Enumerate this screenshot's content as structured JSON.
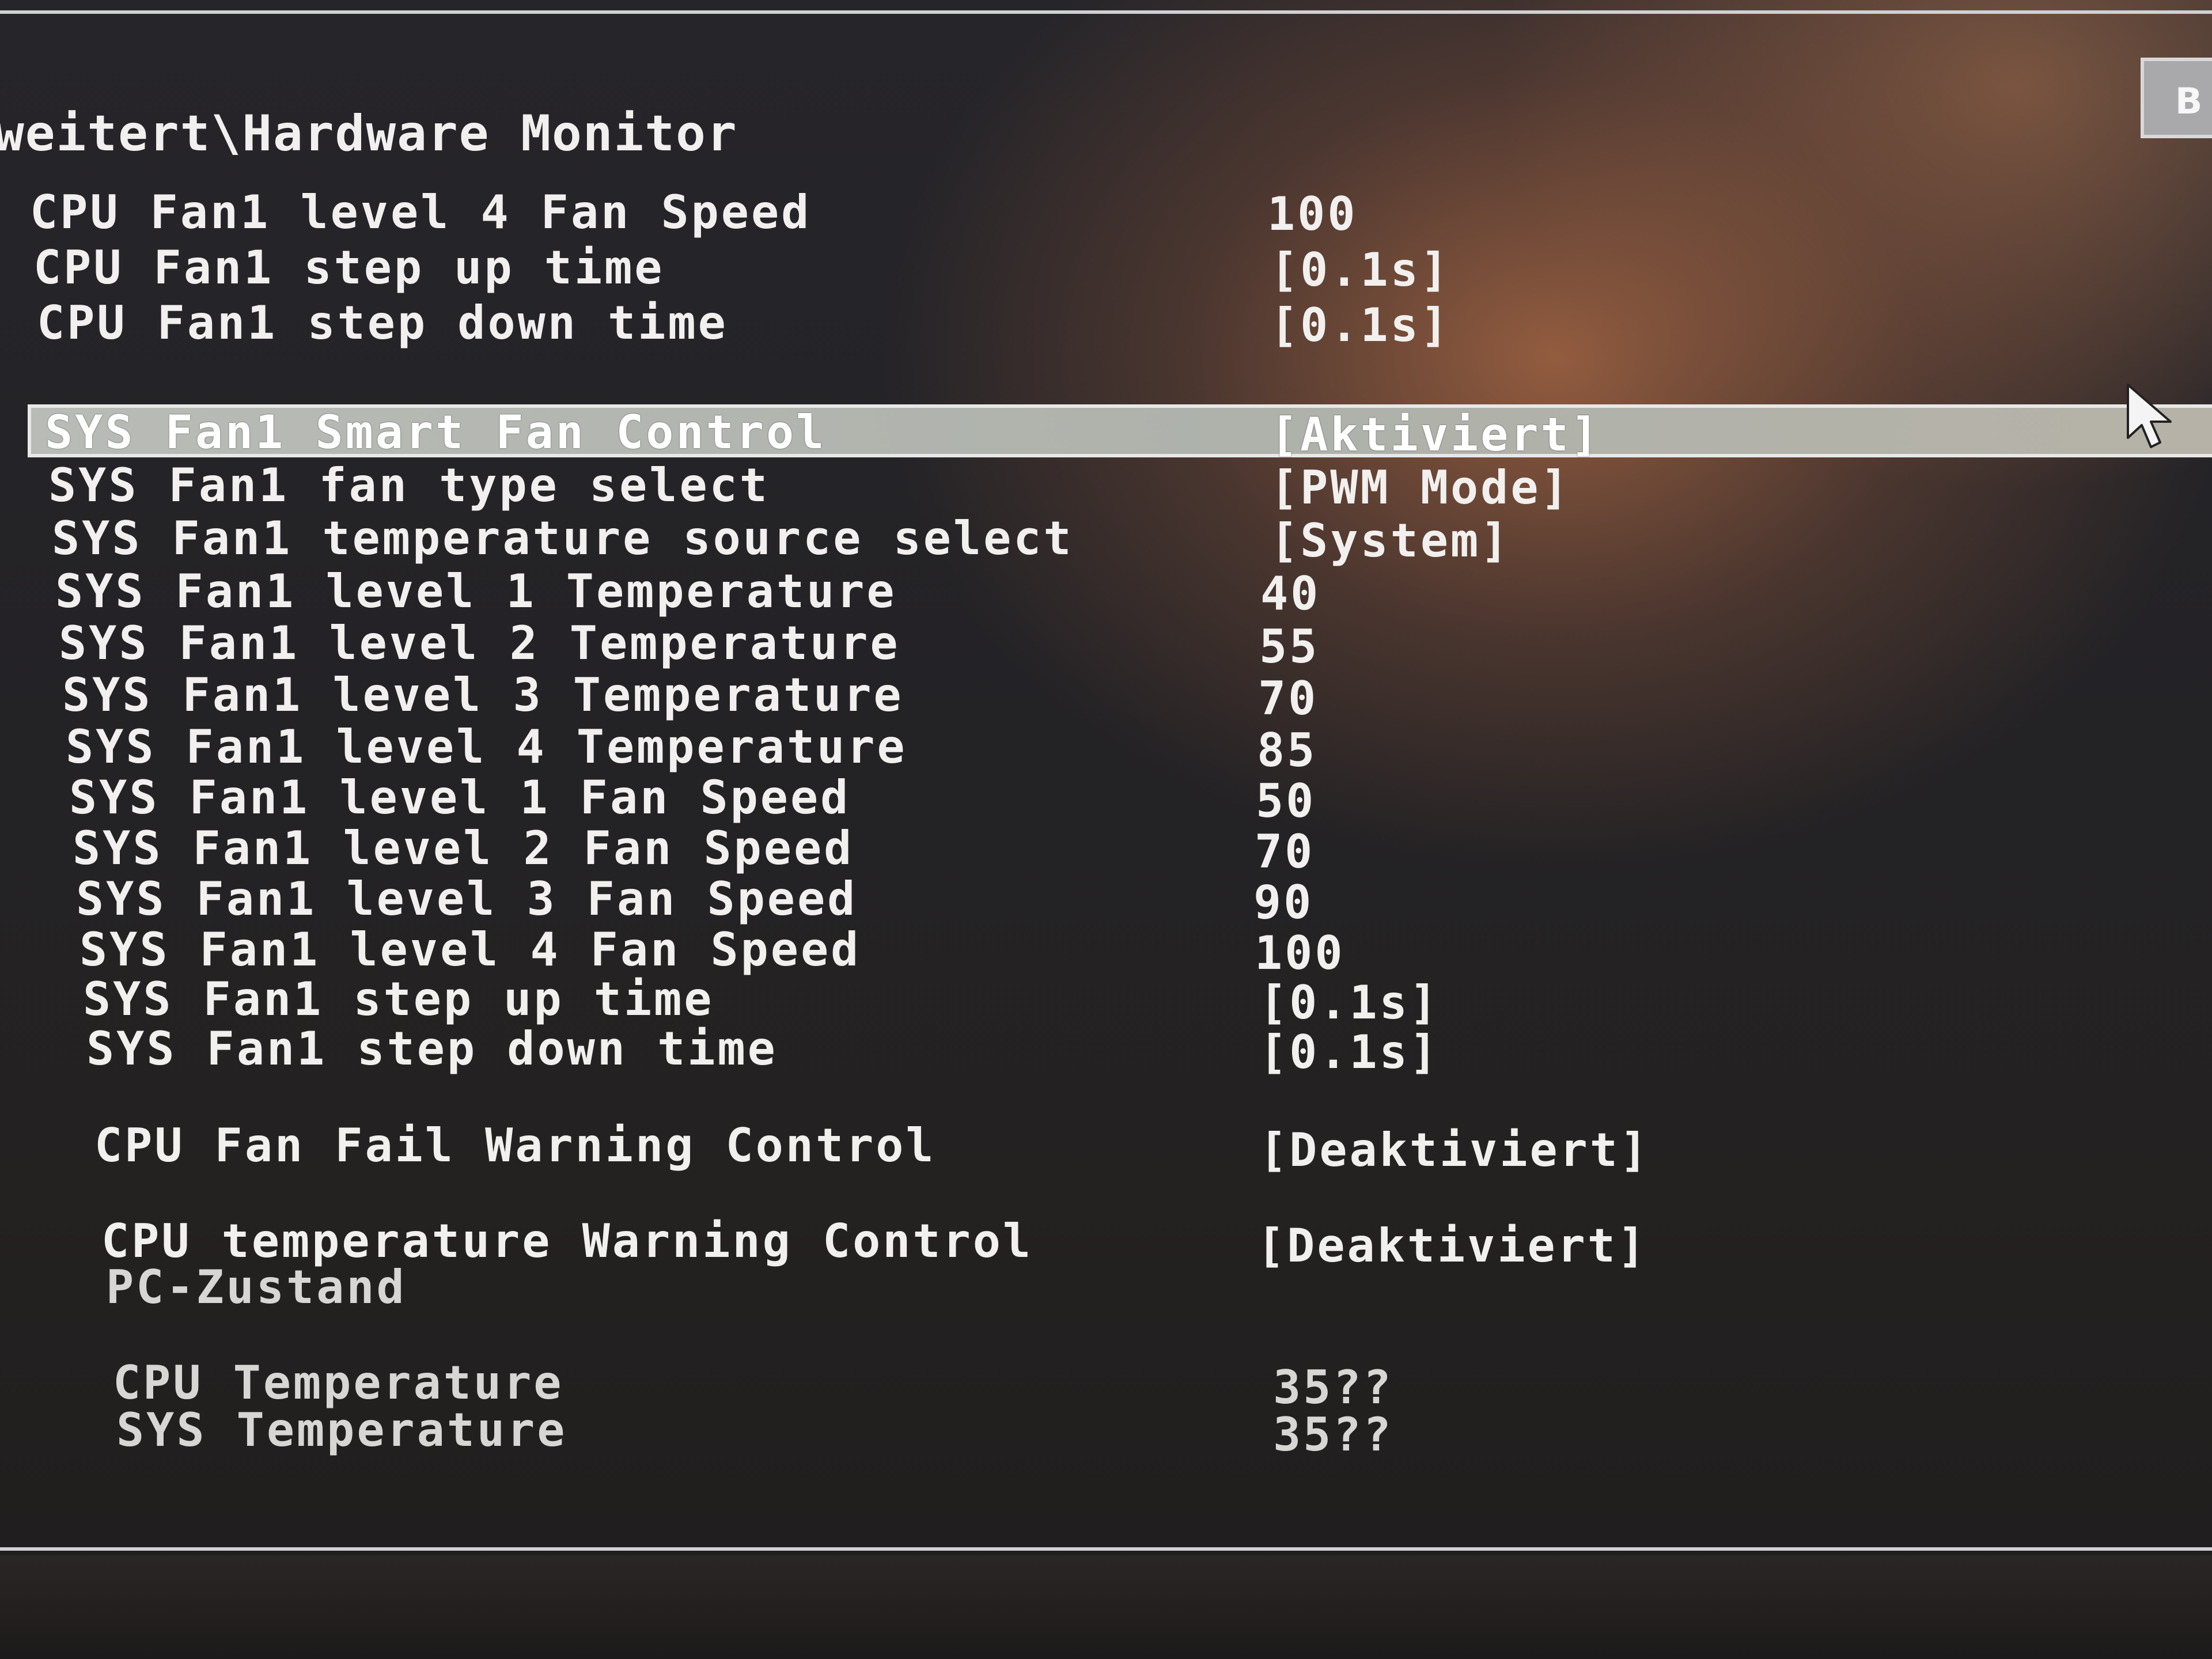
{
  "breadcrumb": "weitert\\Hardware Monitor",
  "back_button": "B",
  "cpu_fan_rows": [
    {
      "label": "CPU Fan1 level 4 Fan Speed",
      "value": "100"
    },
    {
      "label": "CPU Fan1 step up time",
      "value": "[0.1s]"
    },
    {
      "label": "CPU Fan1 step down time",
      "value": "[0.1s]"
    }
  ],
  "sys_fan_rows": [
    {
      "label": "SYS Fan1 Smart Fan Control",
      "value": "[Aktiviert]",
      "selected": true
    },
    {
      "label": "SYS Fan1 fan type select",
      "value": "[PWM Mode]"
    },
    {
      "label": "SYS Fan1 temperature source select",
      "value": "[System]"
    },
    {
      "label": "SYS Fan1 level 1 Temperature",
      "value": "40"
    },
    {
      "label": "SYS Fan1 level 2 Temperature",
      "value": "55"
    },
    {
      "label": "SYS Fan1 level 3 Temperature",
      "value": "70"
    },
    {
      "label": "SYS Fan1 level 4 Temperature",
      "value": "85"
    },
    {
      "label": "SYS Fan1 level 1 Fan Speed",
      "value": "50"
    },
    {
      "label": "SYS Fan1 level 2 Fan Speed",
      "value": "70"
    },
    {
      "label": "SYS Fan1 level 3 Fan Speed",
      "value": "90"
    },
    {
      "label": "SYS Fan1 level 4 Fan Speed",
      "value": "100"
    },
    {
      "label": "SYS Fan1 step up time",
      "value": "[0.1s]"
    },
    {
      "label": "SYS Fan1 step down time",
      "value": "[0.1s]"
    }
  ],
  "warning_rows": [
    {
      "label": "CPU Fan Fail Warning Control",
      "value": "[Deaktiviert]"
    },
    {
      "label": "CPU temperature Warning Control",
      "value": "[Deaktiviert]"
    }
  ],
  "pc_status": {
    "heading": "PC-Zustand",
    "rows": [
      {
        "label": "CPU Temperature",
        "value": "35??"
      },
      {
        "label": "SYS Temperature",
        "value": "35??"
      }
    ]
  }
}
